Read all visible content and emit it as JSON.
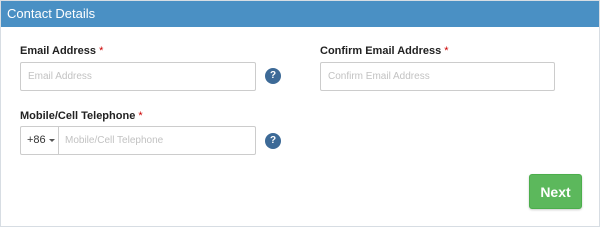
{
  "header": {
    "title": "Contact Details"
  },
  "email": {
    "label": "Email Address",
    "required_mark": "*",
    "placeholder": "Email Address",
    "value": "",
    "help_glyph": "?"
  },
  "confirm_email": {
    "label": "Confirm Email Address",
    "required_mark": "*",
    "placeholder": "Confirm Email Address",
    "value": ""
  },
  "phone": {
    "label": "Mobile/Cell Telephone",
    "required_mark": "*",
    "country_code": "+86",
    "placeholder": "Mobile/Cell Telephone",
    "value": "",
    "help_glyph": "?"
  },
  "actions": {
    "next_label": "Next"
  },
  "colors": {
    "header_bg": "#4a90c4",
    "help_icon": "#3d6a97",
    "next_button": "#5cb85c",
    "required": "#cc0000"
  }
}
